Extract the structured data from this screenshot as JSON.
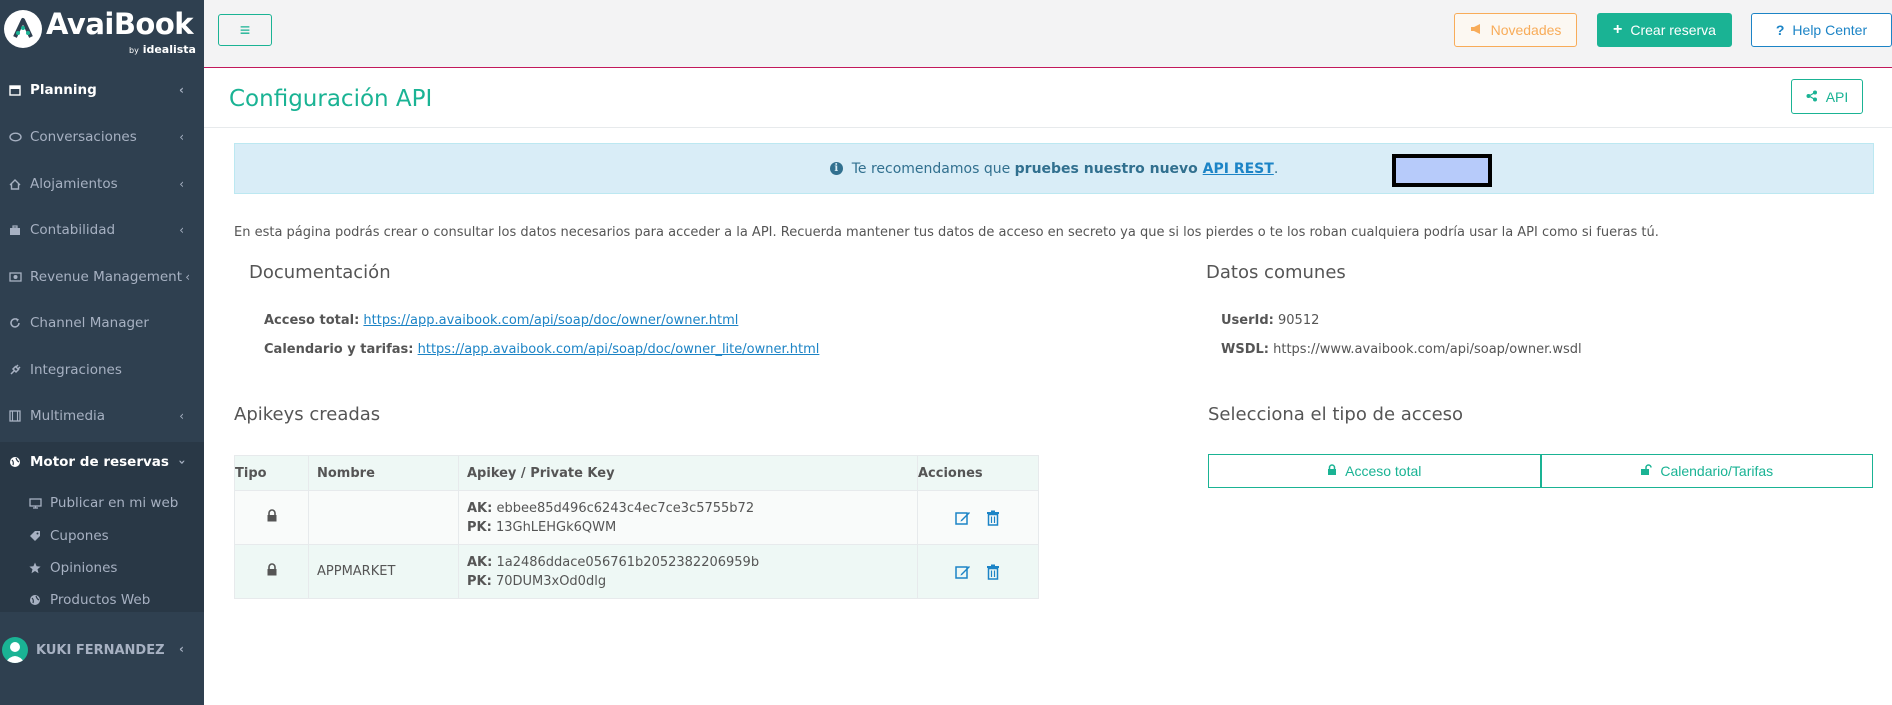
{
  "brand": {
    "name": "AvaiBook",
    "by_prefix": "by",
    "by_name": "idealista"
  },
  "sidebar": {
    "items": [
      {
        "label": "Planning",
        "icon": "calendar-icon"
      },
      {
        "label": "Conversaciones",
        "icon": "chat-icon"
      },
      {
        "label": "Alojamientos",
        "icon": "home-icon"
      },
      {
        "label": "Contabilidad",
        "icon": "briefcase-icon"
      },
      {
        "label": "Revenue Management",
        "icon": "money-icon"
      },
      {
        "label": "Channel Manager",
        "icon": "refresh-icon"
      },
      {
        "label": "Integraciones",
        "icon": "plug-icon"
      },
      {
        "label": "Multimedia",
        "icon": "film-icon"
      },
      {
        "label": "Motor de reservas",
        "icon": "globe-icon"
      }
    ],
    "subitems": [
      {
        "label": "Publicar en mi web",
        "icon": "desktop-icon"
      },
      {
        "label": "Cupones",
        "icon": "tag-icon"
      },
      {
        "label": "Opiniones",
        "icon": "star-icon"
      },
      {
        "label": "Productos Web",
        "icon": "globe-icon"
      }
    ],
    "user": {
      "name": "KUKI FERNANDEZ"
    }
  },
  "topbar": {
    "menu_icon": "≡",
    "novedades": "Novedades",
    "crear_reserva": "Crear reserva",
    "help_center": "Help Center"
  },
  "page": {
    "title": "Configuración API",
    "api_button": "API"
  },
  "alert": {
    "before": "Te recomendamos que ",
    "bold": "pruebes nuestro nuevo ",
    "link": "API REST",
    "after": "."
  },
  "intro": "En esta página podrás crear o consultar los datos necesarios para acceder a la API. Recuerda mantener tus datos de acceso en secreto ya que si los pierdes o te los roban cualquiera podría usar la API como si fueras tú.",
  "documentacion": {
    "title": "Documentación",
    "acceso_label": "Acceso total:",
    "acceso_url": "https://app.avaibook.com/api/soap/doc/owner/owner.html",
    "calendario_label": "Calendario y tarifas:",
    "calendario_url": "https://app.avaibook.com/api/soap/doc/owner_lite/owner.html"
  },
  "datos": {
    "title": "Datos comunes",
    "userid_label": "UserId:",
    "userid_value": "90512",
    "wsdl_label": "WSDL:",
    "wsdl_value": "https://www.avaibook.com/api/soap/owner.wsdl"
  },
  "apikeys": {
    "title": "Apikeys creadas",
    "headers": {
      "tipo": "Tipo",
      "nombre": "Nombre",
      "key": "Apikey / Private Key",
      "acciones": "Acciones"
    },
    "ak_label": "AK:",
    "pk_label": "PK:",
    "rows": [
      {
        "nombre": "",
        "ak": "ebbee85d496c6243c4ec7ce3c5755b72",
        "pk": "13GhLEHGk6QWM"
      },
      {
        "nombre": "APPMARKET",
        "ak": "1a2486ddace056761b2052382206959b",
        "pk": "70DUM3xOd0dlg"
      }
    ]
  },
  "acceso": {
    "title": "Selecciona el tipo de acceso",
    "total": "Acceso total",
    "calendario": "Calendario/Tarifas"
  }
}
